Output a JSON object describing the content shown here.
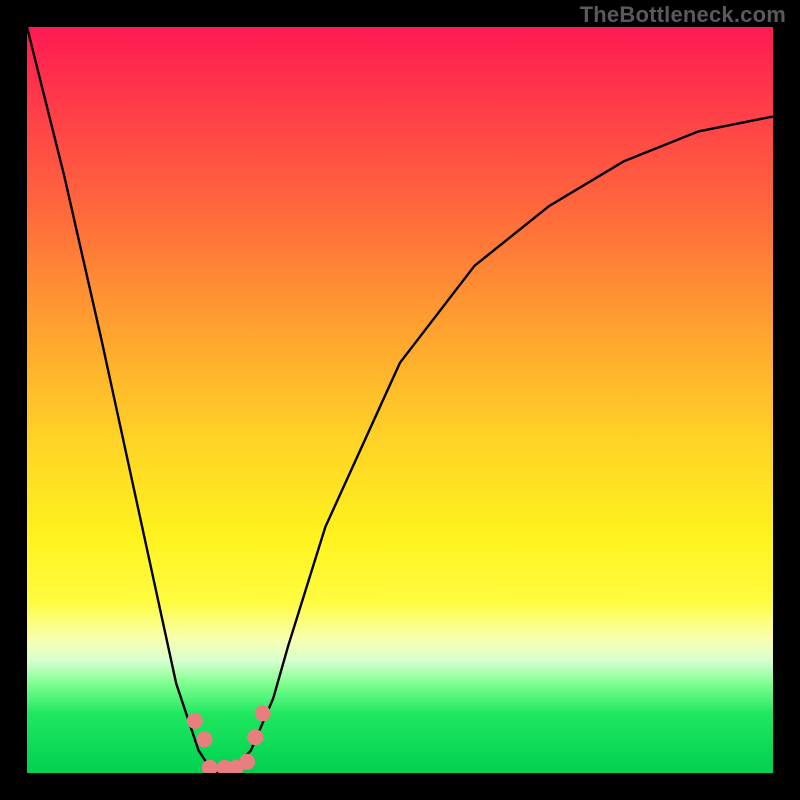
{
  "watermark": "TheBottleneck.com",
  "chart_data": {
    "type": "line",
    "title": "",
    "xlabel": "",
    "ylabel": "",
    "xlim": [
      0,
      100
    ],
    "ylim": [
      0,
      100
    ],
    "grid": false,
    "legend": false,
    "series": [
      {
        "name": "bottleneck-curve",
        "x": [
          0,
          5,
          10,
          15,
          20,
          23,
          25,
          27,
          30,
          33,
          35,
          40,
          50,
          60,
          70,
          80,
          90,
          100
        ],
        "y": [
          100,
          80,
          58,
          35,
          12,
          3,
          0,
          0,
          3,
          10,
          17,
          33,
          55,
          68,
          76,
          82,
          86,
          88
        ]
      }
    ],
    "markers": {
      "name": "dots",
      "x": [
        22.5,
        23.8,
        24.5,
        26.5,
        28.0,
        29.5,
        30.6,
        31.6
      ],
      "y": [
        7.0,
        4.5,
        0.7,
        0.7,
        0.7,
        1.5,
        4.8,
        8.0
      ],
      "color": "#e97e7e",
      "radius_px": 8
    },
    "gradient_stops": [
      {
        "pos": 0.0,
        "color": "#ff1a52"
      },
      {
        "pos": 0.25,
        "color": "#ff6a3c"
      },
      {
        "pos": 0.55,
        "color": "#ffd226"
      },
      {
        "pos": 0.77,
        "color": "#fffc40"
      },
      {
        "pos": 0.88,
        "color": "#80ff90"
      },
      {
        "pos": 1.0,
        "color": "#00d050"
      }
    ]
  }
}
